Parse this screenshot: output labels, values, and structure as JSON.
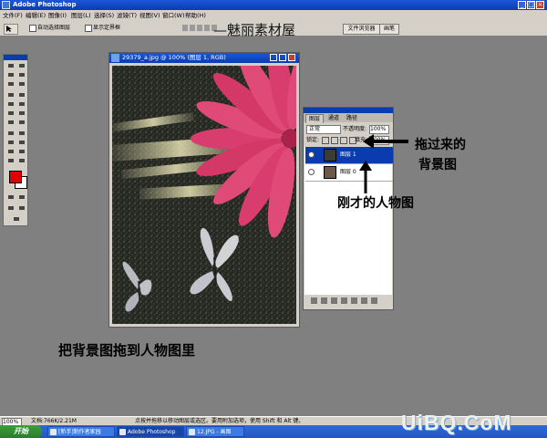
{
  "app": {
    "title": "Adobe Photoshop"
  },
  "menu": [
    "文件(F)",
    "编辑(E)",
    "图像(I)",
    "图层(L)",
    "选择(S)",
    "滤镜(T)",
    "视图(V)",
    "窗口(W)",
    "帮助(H)"
  ],
  "options": {
    "auto_select_label": "自动选择图层",
    "show_bounds_label": "显示定界框",
    "right_tabs": [
      "文件浏览器",
      "画笔"
    ]
  },
  "banner": "—魅丽素材屋",
  "document": {
    "title": "29379_a.jpg @ 100% (图层 1, RGB)"
  },
  "layers_panel": {
    "tabs": [
      "图层",
      "通道",
      "路径"
    ],
    "blend_mode": "正常",
    "opacity_label": "不透明度:",
    "opacity_value": "100%",
    "lock_label": "锁定:",
    "fill_label": "填充:",
    "fill_value": "100%",
    "layers": [
      {
        "name": "图层 1",
        "selected": true
      },
      {
        "name": "图层 0",
        "selected": false
      }
    ]
  },
  "annotations": {
    "drag_bg_line1": "拖过来的",
    "drag_bg_line2": "背景图",
    "person_img": "刚才的人物图",
    "instruction": "把背景图拖到人物图里"
  },
  "status": {
    "zoom": "100%",
    "doc_info": "文档:766K/2.21M",
    "hint": "点按并拖移以移动图层或选区。要用附加选项，使用 Shift 和 Alt 键。"
  },
  "taskbar": {
    "start": "开始",
    "tasks": [
      "[新手]制作者家园",
      "Adobe Photoshop",
      "12.JPG - 画图"
    ]
  },
  "watermark": "UiBQ.CoM",
  "colors": {
    "title_blue": "#0a3cb0",
    "foreground": "#e00000",
    "background": "#ffffff",
    "flower": "#d93c6e"
  },
  "icons": [
    "move-tool-icon",
    "marquee-icon",
    "lasso-icon",
    "magic-wand-icon",
    "crop-icon",
    "brush-icon",
    "eraser-icon",
    "text-icon",
    "pen-icon",
    "hand-icon",
    "zoom-icon",
    "eye-icon",
    "arrow-left-icon",
    "arrow-up-icon"
  ]
}
